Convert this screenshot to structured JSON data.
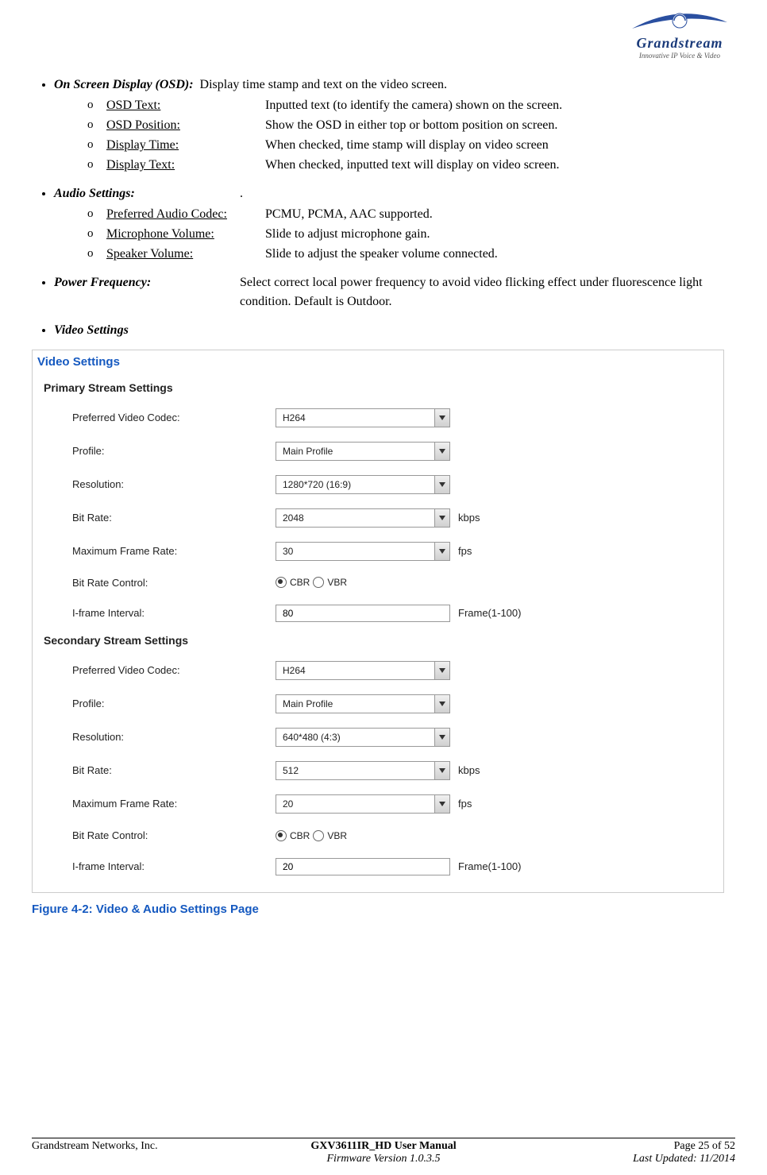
{
  "logo": {
    "brand": "Grandstream",
    "tagline": "Innovative IP Voice & Video"
  },
  "osd": {
    "heading": "On Screen Display (OSD):",
    "desc": "Display time stamp and text on the video screen.",
    "items": [
      {
        "label": "OSD Text:",
        "desc": "Inputted text (to identify the camera) shown on the screen."
      },
      {
        "label": "OSD Position:",
        "desc": "Show the OSD in either top or bottom position on screen."
      },
      {
        "label": "Display Time:",
        "desc": "When checked, time stamp will display on video screen"
      },
      {
        "label": "Display Text:",
        "desc": "When checked, inputted text will display on video screen."
      }
    ]
  },
  "audio": {
    "heading": "Audio Settings:",
    "desc": ".",
    "items": [
      {
        "label": "Preferred Audio Codec:",
        "desc": "PCMU, PCMA, AAC supported."
      },
      {
        "label": "Microphone Volume:",
        "desc": "Slide to adjust microphone gain."
      },
      {
        "label": "Speaker Volume:",
        "desc": "Slide to adjust the speaker volume connected."
      }
    ]
  },
  "power": {
    "heading": "Power Frequency:",
    "desc": "Select correct local power frequency to avoid video flicking effect under fluorescence light condition. Default is Outdoor."
  },
  "video_heading": "Video Settings",
  "panel": {
    "title": "Video Settings",
    "primary_title": "Primary Stream Settings",
    "secondary_title": "Secondary Stream Settings",
    "labels": {
      "codec": "Preferred Video Codec:",
      "profile": "Profile:",
      "resolution": "Resolution:",
      "bitrate": "Bit Rate:",
      "maxfps": "Maximum Frame Rate:",
      "brc": "Bit Rate Control:",
      "iframe": "I-frame Interval:"
    },
    "suffix": {
      "kbps": "kbps",
      "fps": "fps",
      "frame": "Frame(1-100)"
    },
    "radio": {
      "cbr": "CBR",
      "vbr": "VBR"
    },
    "primary": {
      "codec": "H264",
      "profile": "Main Profile",
      "resolution": "1280*720 (16:9)",
      "bitrate": "2048",
      "maxfps": "30",
      "brc_checked": "cbr",
      "iframe": "80"
    },
    "secondary": {
      "codec": "H264",
      "profile": "Main Profile",
      "resolution": "640*480 (4:3)",
      "bitrate": "512",
      "maxfps": "20",
      "brc_checked": "cbr",
      "iframe": "20"
    }
  },
  "figure_caption": "Figure 4-2:  Video & Audio Settings Page",
  "footer": {
    "company": "Grandstream Networks, Inc.",
    "manual": "GXV3611IR_HD User Manual",
    "page": "Page 25 of 52",
    "firmware": "Firmware Version 1.0.3.5",
    "updated": "Last Updated: 11/2014"
  }
}
